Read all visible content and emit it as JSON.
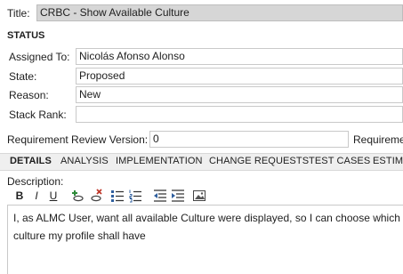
{
  "title": {
    "label": "Title:",
    "value": "CRBC - Show Available Culture"
  },
  "status": {
    "heading": "STATUS",
    "assigned_to": {
      "label": "Assigned To:",
      "value": "Nicolás Afonso Alonso"
    },
    "state": {
      "label": "State:",
      "value": "Proposed"
    },
    "reason": {
      "label": "Reason:",
      "value": "New"
    },
    "stack_rank": {
      "label": "Stack Rank:",
      "value": ""
    }
  },
  "requirement_review": {
    "label": "Requirement Review Version:",
    "value": "0"
  },
  "requirement_truncated_label": "Requiremer",
  "tabs": [
    {
      "label": "DETAILS"
    },
    {
      "label": "ANALYSIS"
    },
    {
      "label": "IMPLEMENTATION"
    },
    {
      "label": "CHANGE REQUESTS"
    },
    {
      "label": "TEST CASES"
    },
    {
      "label": "ESTIMA"
    }
  ],
  "description": {
    "label": "Description:",
    "toolbar": {
      "bold": "B",
      "italic": "I",
      "underline": "U"
    },
    "line1": "I, as ALMC User, want all available Culture were displayed, so I can choose which",
    "line2": "culture my profile shall have"
  },
  "colors": {
    "accent_red": "#c0392b",
    "accent_green": "#2e8b3a",
    "accent_blue": "#2f5f9e"
  }
}
